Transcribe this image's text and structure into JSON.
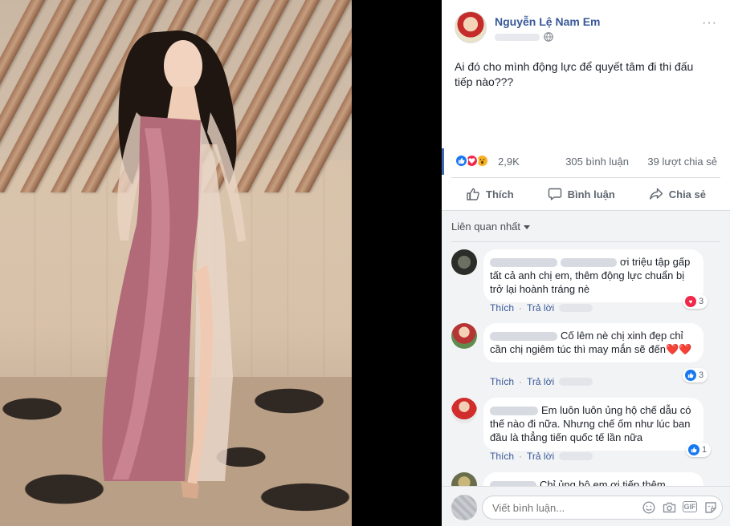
{
  "post": {
    "author": "Nguyễn Lệ Nam Em",
    "text": "Ai đó cho mình động lực để quyết tâm đi thi đấu tiếp nào???",
    "reaction_count": "2,9K",
    "comment_count": "305 bình luận",
    "share_count": "39 lượt chia sẻ",
    "more_label": "···"
  },
  "actions": {
    "like": "Thích",
    "comment": "Bình luận",
    "share": "Chia sẻ"
  },
  "comments": {
    "sort_label": "Liên quan nhất",
    "items": [
      {
        "text": "ơi triệu tập gấp tất cả anh chị em, thêm động lực chuẩn bị trở lại hoành tráng nè",
        "like": "Thích",
        "reply": "Trả lời",
        "reaction_count": "3"
      },
      {
        "text": "Cố lêm nè chị xinh đẹp chỉ cần chị ngiêm túc thì may mắn sẽ đến❤️❤️",
        "like": "Thích",
        "reply": "Trả lời",
        "reaction_count": "3"
      },
      {
        "text": "Em luôn luôn ủng hộ chế dẫu có thế nào đi nữa. Nhưng chế ốm như lúc ban đầu là thẳng tiến quốc tế lần nữa",
        "like": "Thích",
        "reply": "Trả lời",
        "reaction_count": "1"
      },
      {
        "text": "Chỉ ủng hộ em ơi tiếp thêm"
      }
    ]
  },
  "composer": {
    "placeholder": "Viết bình luận...",
    "gif_label": "GIF"
  },
  "icons": [
    "globe-icon",
    "like-icon",
    "comment-icon",
    "share-icon",
    "chevron-down-icon",
    "emoji-icon",
    "camera-icon",
    "sticker-icon"
  ],
  "colors": {
    "name_link": "#385898",
    "like_blue": "#1877f2",
    "love_red": "#f0284a",
    "wow_yellow": "#f7b125"
  }
}
